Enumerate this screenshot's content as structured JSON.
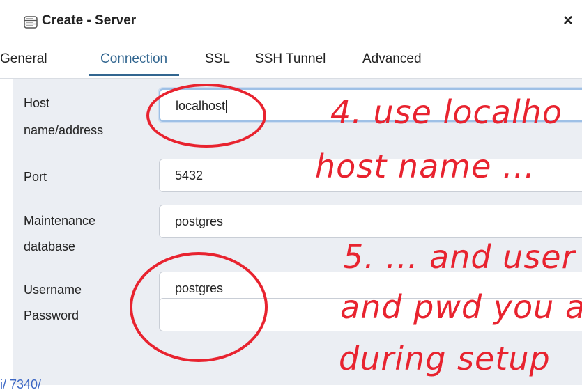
{
  "dialog": {
    "title": "Create - Server",
    "close": "×",
    "tabs": [
      {
        "label": "General"
      },
      {
        "label": "Connection"
      },
      {
        "label": "SSL"
      },
      {
        "label": "SSH Tunnel"
      },
      {
        "label": "Advanced"
      }
    ],
    "active_tab": "Connection"
  },
  "form": {
    "host": {
      "label_line1": "Host",
      "label_line2": "name/address",
      "value": "localhost"
    },
    "port": {
      "label": "Port",
      "value": "5432"
    },
    "maintenance_db": {
      "label_line1": "Maintenance",
      "label_line2": "database",
      "value": "postgres"
    },
    "username": {
      "label": "Username",
      "value": "postgres"
    },
    "password": {
      "label": "Password",
      "value": ""
    }
  },
  "annotations": {
    "note4_line1": "4. use localho",
    "note4_line2": "host name ...",
    "note5_line1": "5. ... and user",
    "note5_line2": "and pwd you a",
    "note5_line3": "during setup"
  },
  "footer": {
    "link_text": "i/ 7340/"
  },
  "colors": {
    "accent": "#326690",
    "panel_bg": "#ebeef3",
    "annotation_red": "#e8232f"
  },
  "icons": {
    "title": "server-icon",
    "close": "close-icon"
  }
}
